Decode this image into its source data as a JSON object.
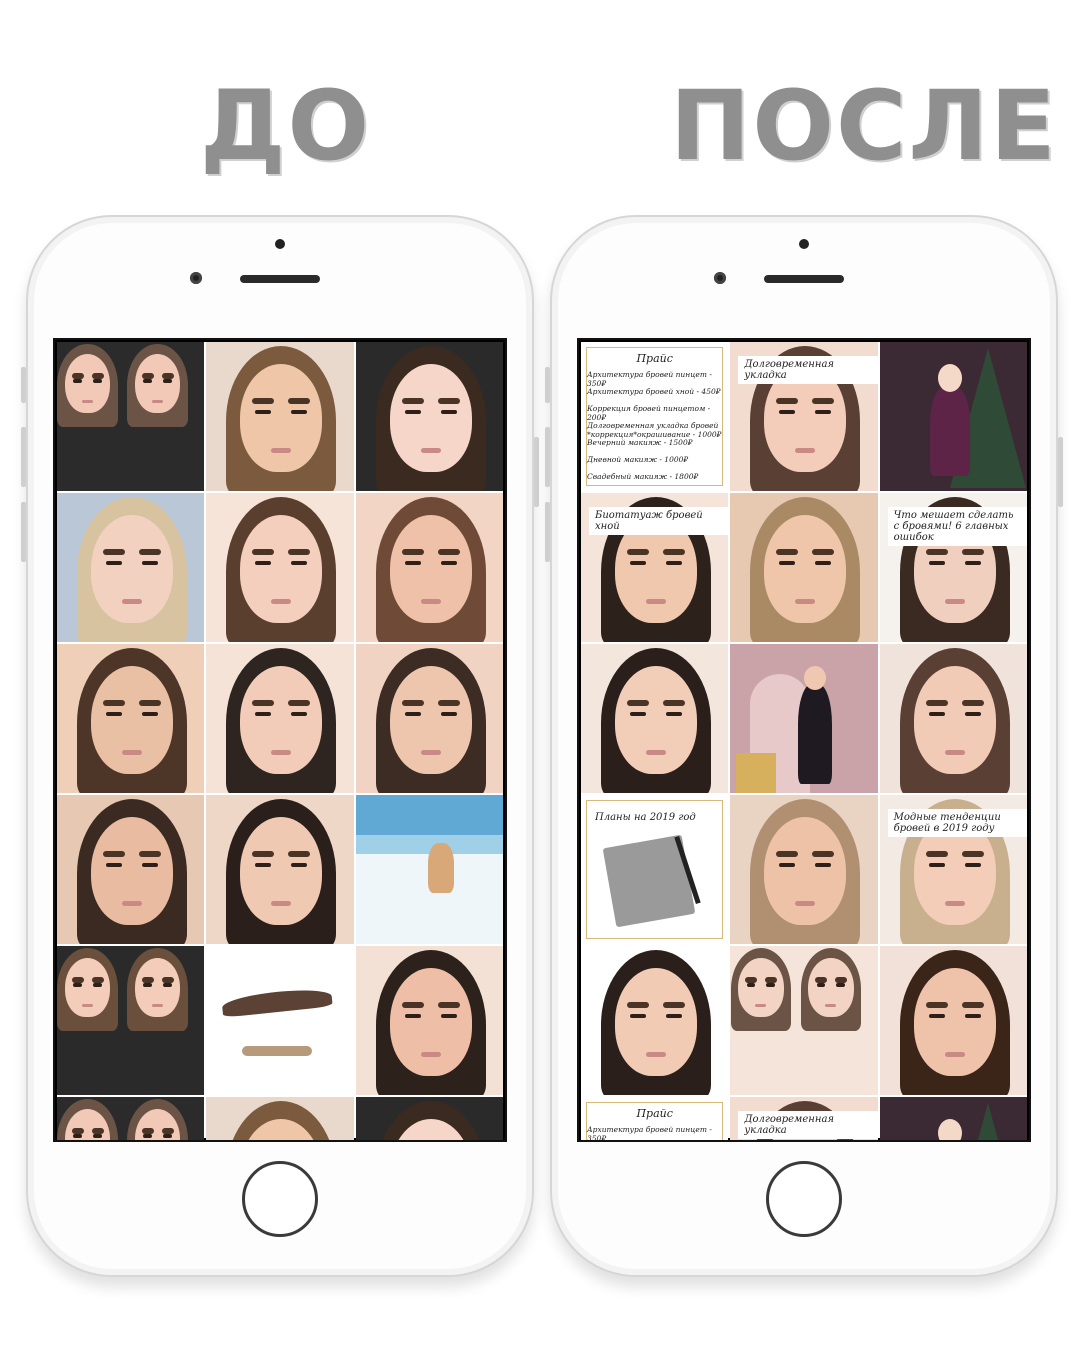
{
  "headings": {
    "before": "ДО",
    "after": "ПОСЛЕ"
  },
  "before_grid": {
    "cells": [
      {
        "kind": "photo",
        "bg": "#2b2b2b",
        "skin": "#f1c9b6",
        "hair": "#6b5446",
        "double": true
      },
      {
        "kind": "photo",
        "bg": "#e9d9cc",
        "skin": "#f0c6a8",
        "hair": "#7b5a3e"
      },
      {
        "kind": "photo",
        "bg": "#2a2a2a",
        "skin": "#f6d6c9",
        "hair": "#3a2a20"
      },
      {
        "kind": "photo",
        "bg": "#b9c7d6",
        "skin": "#f3d1c0",
        "hair": "#d8c3a0"
      },
      {
        "kind": "photo",
        "bg": "#f7e4d8",
        "skin": "#f4cfbd",
        "hair": "#5a3f2f"
      },
      {
        "kind": "photo",
        "bg": "#f3d5c6",
        "skin": "#eec1a8",
        "hair": "#6f4b37"
      },
      {
        "kind": "photo",
        "bg": "#f0cfb9",
        "skin": "#eac0a4",
        "hair": "#4d3528"
      },
      {
        "kind": "photo",
        "bg": "#f6e3d7",
        "skin": "#f2ccb8",
        "hair": "#2e2420"
      },
      {
        "kind": "photo",
        "bg": "#f1d3c3",
        "skin": "#eec5ad",
        "hair": "#3c2c24"
      },
      {
        "kind": "photo",
        "bg": "#e6c8b3",
        "skin": "#e9bca1",
        "hair": "#3b2a22"
      },
      {
        "kind": "photo",
        "bg": "#efd7c8",
        "skin": "#f0c9b3",
        "hair": "#2a1f1a"
      },
      {
        "kind": "beach",
        "bg": "#9fd0e8",
        "skin": "#f5efe6",
        "hair": "#c7a477"
      },
      {
        "kind": "photo",
        "bg": "#2a2a2a",
        "skin": "#f3cdb9",
        "hair": "#6b4f3d",
        "double": true
      },
      {
        "kind": "brow",
        "bg": "#ffffff",
        "skin": "#ffffff",
        "hair": "#5b4234"
      },
      {
        "kind": "photo",
        "bg": "#f4e1d6",
        "skin": "#eebfa6",
        "hair": "#2d211b"
      },
      {
        "kind": "photo",
        "bg": "#2b2b2b",
        "skin": "#f1c9b6",
        "hair": "#6b5446",
        "double": true
      },
      {
        "kind": "photo",
        "bg": "#e9d9cc",
        "skin": "#f0c6a8",
        "hair": "#7b5a3e"
      },
      {
        "kind": "photo",
        "bg": "#2a2a2a",
        "skin": "#f6d6c9",
        "hair": "#3a2a20"
      }
    ]
  },
  "after_grid": {
    "price_title": "Прайс",
    "price_lines": [
      "Архитектура бровей пинцет - 350₽",
      "Архитектура бровей хной - 450₽",
      "Коррекция бровей пинцетом - 200₽",
      "Долговременная укладка бровей *коррекция*окрашивание - 1000₽",
      "Вечерний макияж - 1500₽",
      "Дневной макияж - 1000₽",
      "Свадебный макияж - 1800₽"
    ],
    "price_lines_short": [
      "Архитектура бровей пинцет - 350₽",
      "Архитектура бровей хной - 450₽"
    ],
    "labels": {
      "long_term": "Долговременная укладка",
      "biotattoo": "Биотатуаж бровей хной",
      "mistakes": "Что мешает сделать с бровями! 6 главных ошибок",
      "plans": "Планы на 2019 год",
      "trends": "Модные тенденции бровей в 2019 году"
    },
    "cells": [
      {
        "kind": "price"
      },
      {
        "kind": "photo",
        "bg": "#f2dccf",
        "skin": "#f3cdb9",
        "hair": "#5a4034",
        "label": "long_term"
      },
      {
        "kind": "tree",
        "bg": "#3b2a33",
        "skin": "#f4d8c8",
        "hair": "#8a6a4f"
      },
      {
        "kind": "photo",
        "bg": "#f4e4d9",
        "skin": "#f0c8ae",
        "hair": "#2d211b",
        "label": "biotattoo"
      },
      {
        "kind": "photo",
        "bg": "#e6c9b0",
        "skin": "#efc6aa",
        "hair": "#a98a64"
      },
      {
        "kind": "photo",
        "bg": "#f5f1ec",
        "skin": "#f1cfbf",
        "hair": "#3a2a22",
        "label": "mistakes"
      },
      {
        "kind": "photo",
        "bg": "#f3e6dd",
        "skin": "#f2cdb8",
        "hair": "#2a1f1a"
      },
      {
        "kind": "party",
        "bg": "#c9a3a8",
        "skin": "#f0c7b1",
        "hair": "#5a3b2b"
      },
      {
        "kind": "photo",
        "bg": "#efe3dc",
        "skin": "#f2cbb6",
        "hair": "#5a4034"
      },
      {
        "kind": "notebook",
        "bg": "#ffffff",
        "label": "plans"
      },
      {
        "kind": "photo",
        "bg": "#e9d4c4",
        "skin": "#eec2a7",
        "hair": "#b09070"
      },
      {
        "kind": "photo",
        "bg": "#f3eae3",
        "skin": "#f3cdb7",
        "hair": "#c8b08e",
        "label": "trends"
      },
      {
        "kind": "photo",
        "bg": "#ffffff",
        "skin": "#f2cbb5",
        "hair": "#2a1f1a"
      },
      {
        "kind": "photo",
        "bg": "#f4e4da",
        "skin": "#f3d3c4",
        "hair": "#6b5446",
        "double": true
      },
      {
        "kind": "photo",
        "bg": "#f2e1d8",
        "skin": "#efc3aa",
        "hair": "#3b2418"
      },
      {
        "kind": "price_short"
      },
      {
        "kind": "photo",
        "bg": "#f2dccf",
        "skin": "#f3cdb9",
        "hair": "#5a4034",
        "label": "long_term"
      },
      {
        "kind": "tree",
        "bg": "#3b2a33",
        "skin": "#f4d8c8",
        "hair": "#8a6a4f"
      }
    ]
  }
}
